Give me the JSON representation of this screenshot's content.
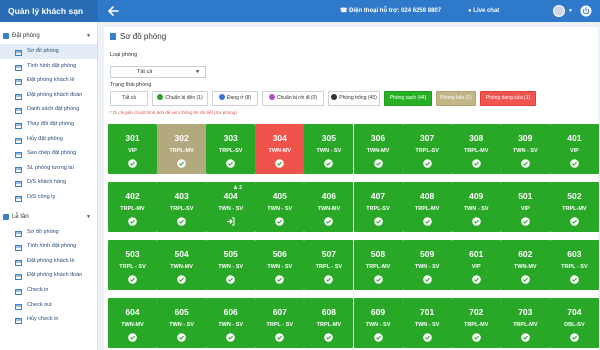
{
  "header": {
    "brand": "Quản lý khách sạn",
    "hotline": "Điện thoại hỗ trợ: 024 6259 8807",
    "livechat": "Live chat",
    "accent": "#2e79c9"
  },
  "sidebar": {
    "section1": "Đặt phòng",
    "items1": [
      "Sơ đồ phòng",
      "Tình hình đặt phòng",
      "Đặt phòng khách lẻ",
      "Đặt phòng khách đoàn",
      "Danh sách đặt phòng",
      "Thay đổi đặt phòng",
      "Hủy đặt phòng",
      "Sao chép đặt phòng",
      "SL phòng tương lai",
      "D/S khách hàng",
      "D/S công ty"
    ],
    "section2": "Lễ tân",
    "items2": [
      "Sơ đồ phòng",
      "Tình hình đặt phòng",
      "Đặt phòng khách lẻ",
      "Đặt phòng khách đoàn",
      "Check in",
      "Check out",
      "Hủy check in"
    ]
  },
  "main": {
    "title": "Sơ đồ phòng",
    "room_type_label": "Loại phòng",
    "room_type_value": "Tất cả",
    "status_label": "Trạng thái phòng",
    "note": "* Di chuyển chuột hình ảnh để xem thông tin chi tiết (Sơ phòng)",
    "filters": [
      {
        "label": "Tất cả",
        "style": "plain",
        "icon": ""
      },
      {
        "label": "Chuẩn bị đến (1)",
        "style": "plain",
        "icon": "person-arrive-icon"
      },
      {
        "label": "Đang ở (8)",
        "style": "plain",
        "icon": "person-stay-icon"
      },
      {
        "label": "Chuẩn bị rời đi (0)",
        "style": "plain",
        "icon": "person-leave-icon"
      },
      {
        "label": "Phòng trống (45)",
        "style": "plain",
        "icon": "check-circle-icon"
      },
      {
        "label": "Phòng sạch (44)",
        "style": "green",
        "icon": ""
      },
      {
        "label": "Phòng bẩn (1)",
        "style": "tan",
        "icon": ""
      },
      {
        "label": "Phòng đang sửa (1)",
        "style": "red",
        "icon": ""
      }
    ],
    "rooms": [
      [
        {
          "num": "301",
          "type": "VIP",
          "color": "g",
          "status": "check"
        },
        {
          "num": "302",
          "type": "TRPL-MV",
          "color": "t",
          "status": "check"
        },
        {
          "num": "303",
          "type": "TRPL-SV",
          "color": "g",
          "status": "check"
        },
        {
          "num": "304",
          "type": "TWN-MV",
          "color": "r",
          "status": "check"
        },
        {
          "num": "305",
          "type": "TWN - SV",
          "color": "g",
          "status": "check"
        },
        {
          "num": "306",
          "type": "TWN-MV",
          "color": "g",
          "status": "check"
        },
        {
          "num": "307",
          "type": "TRPL-SV",
          "color": "g",
          "status": "check"
        },
        {
          "num": "308",
          "type": "TRPL-MV",
          "color": "g",
          "status": "check"
        },
        {
          "num": "309",
          "type": "TWN - SV",
          "color": "g",
          "status": "check"
        },
        {
          "num": "401",
          "type": "VIP",
          "color": "g",
          "status": "check"
        }
      ],
      [
        {
          "num": "402",
          "type": "TRPL-MV",
          "color": "g",
          "status": "check"
        },
        {
          "num": "403",
          "type": "TRPL-SV",
          "color": "g",
          "status": "check"
        },
        {
          "num": "404",
          "type": "TWN - SV",
          "color": "g",
          "status": "login",
          "guest": "2"
        },
        {
          "num": "405",
          "type": "TWN - SV",
          "color": "g",
          "status": "check"
        },
        {
          "num": "406",
          "type": "TWN-MV",
          "color": "g",
          "status": "check"
        },
        {
          "num": "407",
          "type": "TRPL-SV",
          "color": "g",
          "status": "check"
        },
        {
          "num": "408",
          "type": "TRPL-MV",
          "color": "g",
          "status": "check"
        },
        {
          "num": "409",
          "type": "TWN - SV",
          "color": "g",
          "status": "check"
        },
        {
          "num": "501",
          "type": "VIP",
          "color": "g",
          "status": "check"
        },
        {
          "num": "502",
          "type": "TRPL-MV",
          "color": "g",
          "status": "check"
        }
      ],
      [
        {
          "num": "503",
          "type": "TRPL - SV",
          "color": "g",
          "status": "check"
        },
        {
          "num": "504",
          "type": "TWN-MV",
          "color": "g",
          "status": "check"
        },
        {
          "num": "505",
          "type": "TWN - SV",
          "color": "g",
          "status": "check"
        },
        {
          "num": "506",
          "type": "TWN - SV",
          "color": "g",
          "status": "check"
        },
        {
          "num": "507",
          "type": "TRPL - SV",
          "color": "g",
          "status": "check"
        },
        {
          "num": "508",
          "type": "TRPL-MV",
          "color": "g",
          "status": "check"
        },
        {
          "num": "509",
          "type": "TWN - SV",
          "color": "g",
          "status": "check"
        },
        {
          "num": "601",
          "type": "VIP",
          "color": "g",
          "status": "check"
        },
        {
          "num": "602",
          "type": "TWN-MV",
          "color": "g",
          "status": "check"
        },
        {
          "num": "603",
          "type": "TRPL - SV",
          "color": "g",
          "status": "check"
        }
      ],
      [
        {
          "num": "604",
          "type": "TWN-MV",
          "color": "g",
          "status": "check"
        },
        {
          "num": "605",
          "type": "TWN - SV",
          "color": "g",
          "status": "check"
        },
        {
          "num": "606",
          "type": "TWN - SV",
          "color": "g",
          "status": "check"
        },
        {
          "num": "607",
          "type": "TRPL - SV",
          "color": "g",
          "status": "check"
        },
        {
          "num": "608",
          "type": "TRPL-MV",
          "color": "g",
          "status": "check"
        },
        {
          "num": "609",
          "type": "TWN - SV",
          "color": "g",
          "status": "check"
        },
        {
          "num": "701",
          "type": "TWN - SV",
          "color": "g",
          "status": "check"
        },
        {
          "num": "702",
          "type": "TRPL-MV",
          "color": "g",
          "status": "check"
        },
        {
          "num": "703",
          "type": "TRPL-MV",
          "color": "g",
          "status": "check"
        },
        {
          "num": "704",
          "type": "DBL-SV",
          "color": "g",
          "status": "check"
        }
      ]
    ]
  }
}
